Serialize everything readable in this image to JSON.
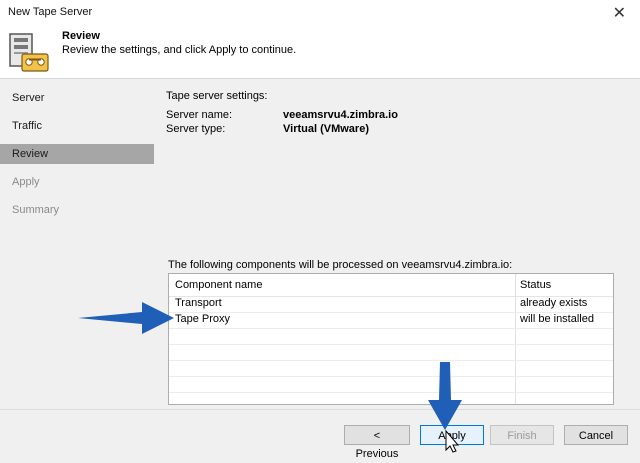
{
  "window": {
    "title": "New Tape Server"
  },
  "header": {
    "title": "Review",
    "subtitle": "Review the settings, and click Apply to continue."
  },
  "sidebar": {
    "items": [
      {
        "label": "Server",
        "state": "done"
      },
      {
        "label": "Traffic",
        "state": "done"
      },
      {
        "label": "Review",
        "state": "active"
      },
      {
        "label": "Apply",
        "state": "disabled"
      },
      {
        "label": "Summary",
        "state": "disabled"
      }
    ]
  },
  "settings": {
    "heading": "Tape server settings:",
    "rows": [
      {
        "label": "Server name:",
        "value": "veeamsrvu4.zimbra.io"
      },
      {
        "label": "Server type:",
        "value": "Virtual (VMware)"
      }
    ]
  },
  "components": {
    "heading": "The following components will be processed on veeamsrvu4.zimbra.io:",
    "columns": [
      "Component name",
      "Status"
    ],
    "rows": [
      {
        "name": "Transport",
        "status": "already exists"
      },
      {
        "name": "Tape Proxy",
        "status": "will be installed"
      }
    ]
  },
  "buttons": {
    "previous": "< Previous",
    "apply": "Apply",
    "finish": "Finish",
    "cancel": "Cancel"
  },
  "colors": {
    "annotation_arrow": "#1f5fb8",
    "primary_border": "#0078d7",
    "active_step": "#a6a6a6"
  },
  "icons": {
    "close": "close-icon",
    "wizard": "tape-server-icon"
  }
}
